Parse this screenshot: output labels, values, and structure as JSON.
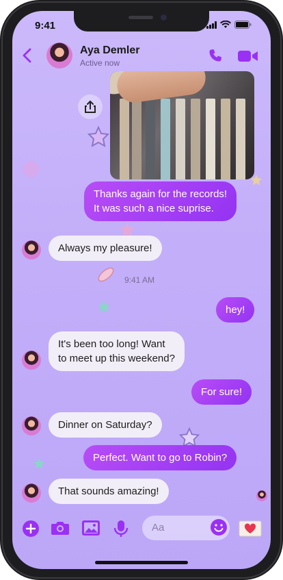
{
  "status": {
    "time": "9:41"
  },
  "contact": {
    "name": "Aya Demler",
    "presence": "Active now"
  },
  "messages": [
    {
      "direction": "out",
      "text_line1": "Thanks again for the records!",
      "text_line2": "It was such a nice suprise."
    },
    {
      "direction": "in",
      "text": "Always my pleasure!"
    },
    {
      "direction": "out",
      "text": "hey!"
    },
    {
      "direction": "in",
      "text_line1": "It's been too long! Want",
      "text_line2": "to meet up this weekend?"
    },
    {
      "direction": "out",
      "text": "For sure!"
    },
    {
      "direction": "in",
      "text": "Dinner on Saturday?"
    },
    {
      "direction": "out",
      "text": "Perfect. Want to go to Robin?"
    },
    {
      "direction": "in",
      "text": "That sounds amazing!"
    }
  ],
  "timestamp": "9:41 AM",
  "composer": {
    "placeholder": "Aa"
  },
  "icons": {
    "back": "chevron-left-icon",
    "call": "phone-icon",
    "video": "video-camera-icon",
    "share": "share-icon",
    "add": "plus-circle-icon",
    "camera": "camera-icon",
    "gallery": "image-icon",
    "mic": "microphone-icon",
    "emoji": "smiley-icon",
    "heart": "heart-envelope-icon"
  },
  "colors": {
    "accent": "#9b30f5",
    "background": "#c4b1f9",
    "bubble_in": "#f2eef8"
  }
}
